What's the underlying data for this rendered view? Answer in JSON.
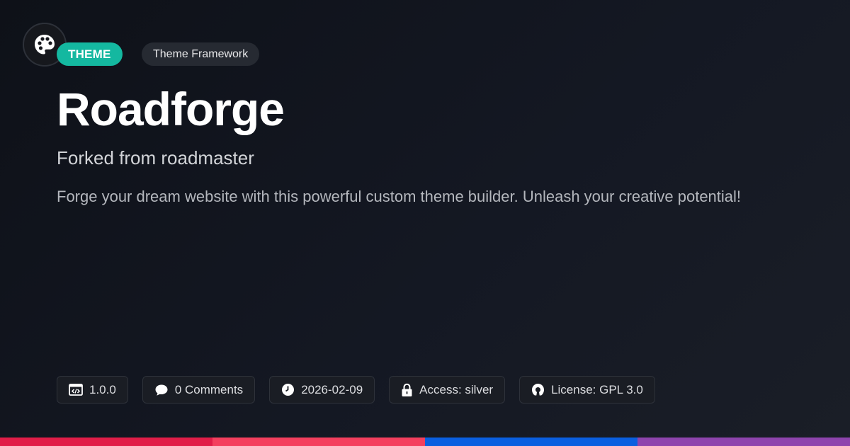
{
  "badges": {
    "type_label": "THEME",
    "category_label": "Theme Framework"
  },
  "title": "Roadforge",
  "subtitle": "Forked from roadmaster",
  "description": "Forge your dream website with this powerful custom theme builder. Unleash your creative potential!",
  "meta": [
    {
      "icon": "code-icon",
      "text": "1.0.0"
    },
    {
      "icon": "comment-icon",
      "text": "0 Comments"
    },
    {
      "icon": "clock-icon",
      "text": "2026-02-09"
    },
    {
      "icon": "lock-icon",
      "text": "Access: silver"
    },
    {
      "icon": "open-source-icon",
      "text": "License: GPL 3.0"
    }
  ],
  "colors": {
    "accent": "#14b8a0",
    "bar": [
      "#e11d48",
      "#f43f5e",
      "#0a5fe0",
      "#8e44ad"
    ]
  }
}
